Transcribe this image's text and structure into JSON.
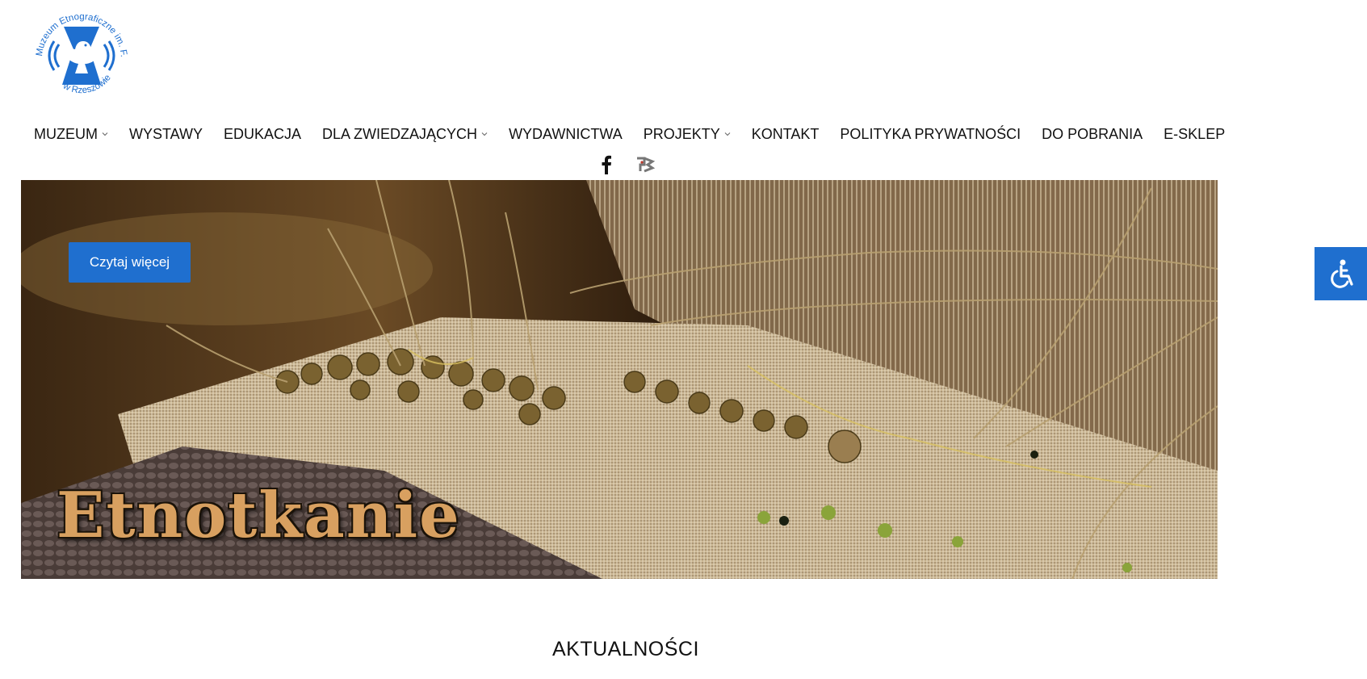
{
  "logo": {
    "text_top": "Muzeum Etnograficzne im. F. Kotuli",
    "text_bottom": "w Rzeszowie",
    "icon": "bird-on-pedestal-logo",
    "accent": "#1f6fcf"
  },
  "nav": {
    "items": [
      {
        "label": "MUZEUM",
        "dropdown": true
      },
      {
        "label": "WYSTAWY",
        "dropdown": false
      },
      {
        "label": "EDUKACJA",
        "dropdown": false
      },
      {
        "label": "DLA ZWIEDZAJĄCYCH",
        "dropdown": true
      },
      {
        "label": "WYDAWNICTWA",
        "dropdown": false
      },
      {
        "label": "PROJEKTY",
        "dropdown": true
      },
      {
        "label": "KONTAKT",
        "dropdown": false
      },
      {
        "label": "POLITYKA PRYWATNOŚCI",
        "dropdown": false
      },
      {
        "label": "DO POBRANIA",
        "dropdown": false
      },
      {
        "label": "E-SKLEP",
        "dropdown": false
      }
    ]
  },
  "social": {
    "icons": [
      "facebook-icon",
      "bip-icon"
    ]
  },
  "hero": {
    "button_label": "Czytaj więcej",
    "title": "Etnotkanie",
    "button_color": "#1f6fcf"
  },
  "section": {
    "title": "AKTUALNOŚCI"
  },
  "accessibility": {
    "icon": "wheelchair-icon",
    "color": "#1f6fcf"
  }
}
